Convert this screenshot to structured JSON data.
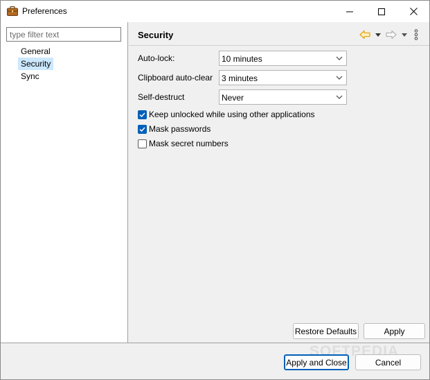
{
  "window": {
    "title": "Preferences",
    "icon": "briefcase-icon"
  },
  "sidebar": {
    "filter_placeholder": "type filter text",
    "items": [
      {
        "label": "General",
        "selected": false
      },
      {
        "label": "Security",
        "selected": true
      },
      {
        "label": "Sync",
        "selected": false
      }
    ]
  },
  "page": {
    "title": "Security",
    "nav_icons": [
      "back-arrow-icon",
      "dropdown-icon",
      "forward-arrow-icon",
      "dropdown-icon",
      "kebab-menu-icon"
    ],
    "fields": {
      "auto_lock": {
        "label": "Auto-lock:",
        "value": "10 minutes"
      },
      "clipboard": {
        "label": "Clipboard auto-clear",
        "value": "3 minutes"
      },
      "self_destruct": {
        "label": "Self-destruct",
        "value": "Never"
      }
    },
    "checks": {
      "keep_unlocked": {
        "label": "Keep unlocked while using other applications",
        "checked": true
      },
      "mask_passwords": {
        "label": "Mask passwords",
        "checked": true
      },
      "mask_secret_numbers": {
        "label": "Mask secret numbers",
        "checked": false
      }
    },
    "restore_label": "Restore Defaults",
    "apply_label": "Apply"
  },
  "footer": {
    "apply_close_label": "Apply and Close",
    "cancel_label": "Cancel"
  },
  "watermark": "SOFTPEDIA",
  "colors": {
    "accent": "#005fb8",
    "selection": "#cce8ff",
    "back_arrow": "#e8a317",
    "disabled_arrow": "#b5b5b5"
  }
}
